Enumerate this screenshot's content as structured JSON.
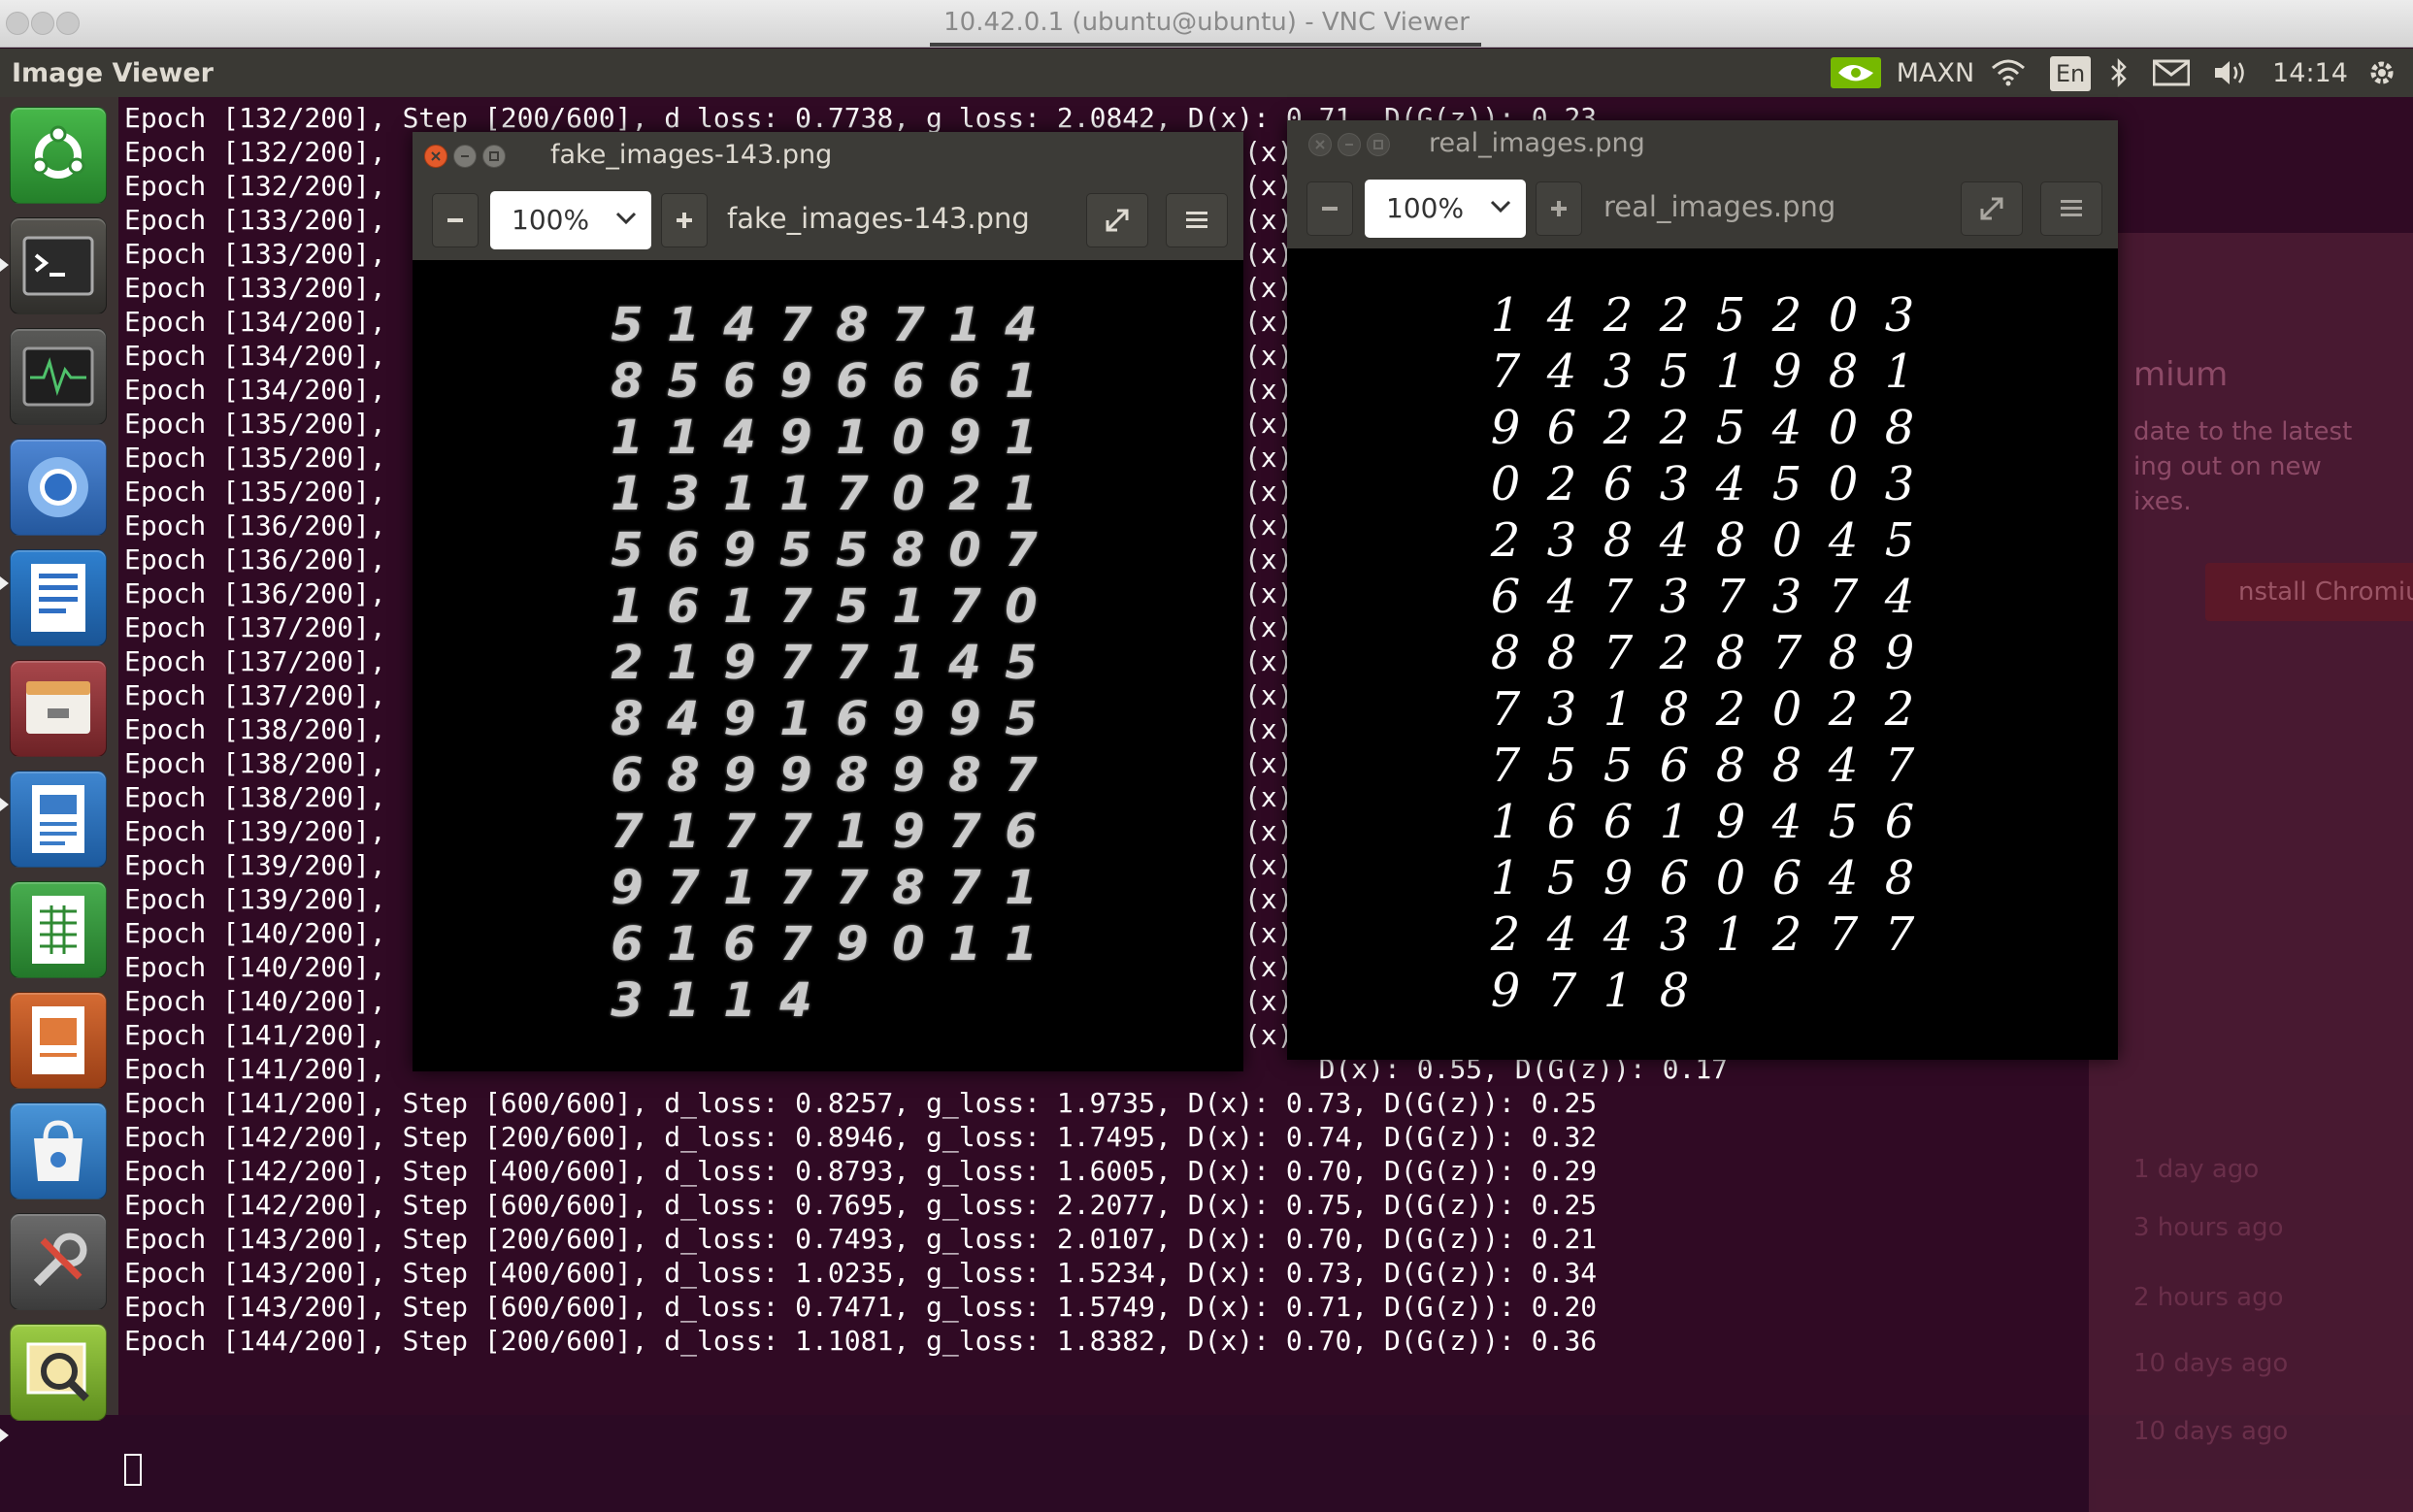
{
  "vnc": {
    "title": "10.42.0.1 (ubuntu@ubuntu) - VNC Viewer"
  },
  "topbar": {
    "app_name": "Image Viewer",
    "power_mode": "MAXN",
    "keyboard_layout": "En",
    "clock": "14:14"
  },
  "launcher": {
    "items": [
      {
        "name": "ubuntu-dash",
        "icon": "ubuntu-logo-icon",
        "color": "#3a9a3a"
      },
      {
        "name": "terminal",
        "icon": "terminal-icon",
        "color": "#3d3c3a"
      },
      {
        "name": "system-monitor",
        "icon": "system-monitor-icon",
        "color": "#3b3b3b"
      },
      {
        "name": "chromium",
        "icon": "chromium-icon",
        "color": "#2f6fb5"
      },
      {
        "name": "text-editor",
        "icon": "text-editor-icon",
        "color": "#1f6fb7"
      },
      {
        "name": "files",
        "icon": "files-icon",
        "color": "#8a2f34"
      },
      {
        "name": "libreoffice-writer",
        "icon": "writer-icon",
        "color": "#1d68b2"
      },
      {
        "name": "libreoffice-calc",
        "icon": "calc-icon",
        "color": "#2d9a3a"
      },
      {
        "name": "libreoffice-impress",
        "icon": "impress-icon",
        "color": "#c0562a"
      },
      {
        "name": "software-center",
        "icon": "software-center-icon",
        "color": "#2f7dc0"
      },
      {
        "name": "system-settings",
        "icon": "settings-icon",
        "color": "#4c4c4c"
      },
      {
        "name": "image-viewer",
        "icon": "image-viewer-icon",
        "color": "#7fae2e"
      }
    ]
  },
  "terminal": {
    "lines": [
      "Epoch [132/200], Step [200/600], d_loss: 0.7738, g_loss: 2.0842, D(x): 0.71, D(G(z)): 0.23",
      "Epoch [132/200],",
      "Epoch [132/200],",
      "Epoch [133/200],",
      "Epoch [133/200],",
      "Epoch [133/200],",
      "Epoch [134/200],",
      "Epoch [134/200],",
      "Epoch [134/200],",
      "Epoch [135/200],",
      "Epoch [135/200],",
      "Epoch [135/200],",
      "Epoch [136/200],",
      "Epoch [136/200],",
      "Epoch [136/200],",
      "Epoch [137/200],",
      "Epoch [137/200],",
      "Epoch [137/200],",
      "Epoch [138/200],",
      "Epoch [138/200],",
      "Epoch [138/200],",
      "Epoch [139/200],",
      "Epoch [139/200],",
      "Epoch [139/200],",
      "Epoch [140/200],",
      "Epoch [140/200],",
      "Epoch [140/200],",
      "Epoch [141/200],",
      "Epoch [141/200],                                                         D(x): 0.55, D(G(z)): 0.17",
      "Epoch [141/200], Step [600/600], d_loss: 0.8257, g_loss: 1.9735, D(x): 0.73, D(G(z)): 0.25",
      "Epoch [142/200], Step [200/600], d_loss: 0.8946, g_loss: 1.7495, D(x): 0.74, D(G(z)): 0.32",
      "Epoch [142/200], Step [400/600], d_loss: 0.8793, g_loss: 1.6005, D(x): 0.70, D(G(z)): 0.29",
      "Epoch [142/200], Step [600/600], d_loss: 0.7695, g_loss: 2.2077, D(x): 0.75, D(G(z)): 0.25",
      "Epoch [143/200], Step [200/600], d_loss: 0.7493, g_loss: 2.0107, D(x): 0.70, D(G(z)): 0.21",
      "Epoch [143/200], Step [400/600], d_loss: 1.0235, g_loss: 1.5234, D(x): 0.73, D(G(z)): 0.34",
      "Epoch [143/200], Step [600/600], d_loss: 0.7471, g_loss: 1.5749, D(x): 0.71, D(G(z)): 0.20",
      "Epoch [144/200], Step [200/600], d_loss: 1.1081, g_loss: 1.8382, D(x): 0.70, D(G(z)): 0.36"
    ],
    "gap_marker": "(x)"
  },
  "background_window": {
    "title_fragment": "mium",
    "text_lines": [
      "date to the latest",
      "ing out on new",
      "ixes."
    ],
    "button": "nstall Chromium",
    "times": [
      "1 day ago",
      "3 hours ago",
      "2 hours ago",
      "10 days ago",
      "10 days ago"
    ]
  },
  "fake_window": {
    "title": "fake_images-143.png",
    "zoom": "100%",
    "filename": "fake_images-143.png",
    "digits": [
      "5",
      "1",
      "4",
      "7",
      "8",
      "7",
      "1",
      "4",
      "8",
      "5",
      "6",
      "9",
      "6",
      "6",
      "6",
      "1",
      "1",
      "1",
      "4",
      "9",
      "1",
      "0",
      "9",
      "1",
      "1",
      "3",
      "1",
      "1",
      "7",
      "0",
      "2",
      "1",
      "5",
      "6",
      "9",
      "5",
      "5",
      "8",
      "0",
      "7",
      "1",
      "6",
      "1",
      "7",
      "5",
      "1",
      "7",
      "0",
      "2",
      "1",
      "9",
      "7",
      "7",
      "1",
      "4",
      "5",
      "8",
      "4",
      "9",
      "1",
      "6",
      "9",
      "9",
      "5",
      "6",
      "8",
      "9",
      "9",
      "8",
      "9",
      "8",
      "7",
      "7",
      "1",
      "7",
      "7",
      "1",
      "9",
      "7",
      "6",
      "9",
      "7",
      "1",
      "7",
      "7",
      "8",
      "7",
      "1",
      "6",
      "1",
      "6",
      "7",
      "9",
      "0",
      "1",
      "1",
      "3",
      "1",
      "1",
      "4"
    ]
  },
  "real_window": {
    "title": "real_images.png",
    "zoom": "100%",
    "filename": "real_images.png",
    "digits": [
      "1",
      "4",
      "2",
      "2",
      "5",
      "2",
      "0",
      "3",
      "7",
      "4",
      "3",
      "5",
      "1",
      "9",
      "8",
      "1",
      "9",
      "6",
      "2",
      "2",
      "5",
      "4",
      "0",
      "8",
      "0",
      "2",
      "6",
      "3",
      "4",
      "5",
      "0",
      "3",
      "2",
      "3",
      "8",
      "4",
      "8",
      "0",
      "4",
      "5",
      "6",
      "4",
      "7",
      "3",
      "7",
      "3",
      "7",
      "4",
      "8",
      "8",
      "7",
      "2",
      "8",
      "7",
      "8",
      "9",
      "7",
      "3",
      "1",
      "8",
      "2",
      "0",
      "2",
      "2",
      "7",
      "5",
      "5",
      "6",
      "8",
      "8",
      "4",
      "7",
      "1",
      "6",
      "6",
      "1",
      "9",
      "4",
      "5",
      "6",
      "1",
      "5",
      "9",
      "6",
      "0",
      "6",
      "4",
      "8",
      "2",
      "4",
      "4",
      "3",
      "1",
      "2",
      "7",
      "7",
      "9",
      "7",
      "1",
      "8"
    ]
  }
}
